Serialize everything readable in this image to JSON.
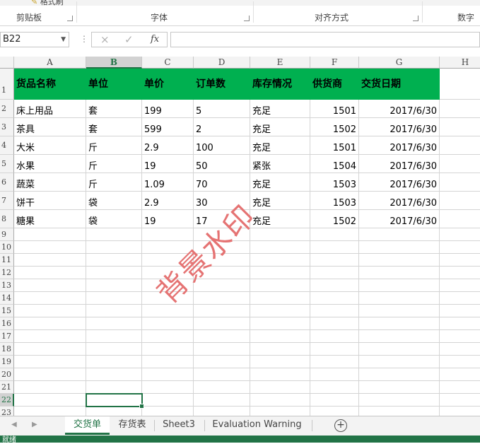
{
  "ribbon": {
    "format_painter": "格式刷",
    "groups": [
      "剪贴板",
      "字体",
      "对齐方式",
      "数字"
    ]
  },
  "formula_bar": {
    "name_box": "B22",
    "cancel_icon": "×",
    "enter_icon": "✓",
    "fx_label": "fx",
    "formula": ""
  },
  "columns": [
    "A",
    "B",
    "C",
    "D",
    "E",
    "F",
    "G",
    "H"
  ],
  "rows": [
    "1",
    "2",
    "3",
    "4",
    "5",
    "6",
    "7",
    "8",
    "9",
    "10",
    "11",
    "12",
    "13",
    "14",
    "15",
    "16",
    "17",
    "18",
    "19",
    "20",
    "21",
    "22",
    "23"
  ],
  "table": {
    "header": [
      "货品名称",
      "单位",
      "单价",
      "订单数",
      "库存情况",
      "供货商",
      "交货日期"
    ],
    "records": [
      [
        "床上用品",
        "套",
        "199",
        "5",
        "充足",
        "1501",
        "2017/6/30"
      ],
      [
        "茶具",
        "套",
        "599",
        "2",
        "充足",
        "1502",
        "2017/6/30"
      ],
      [
        "大米",
        "斤",
        "2.9",
        "100",
        "充足",
        "1501",
        "2017/6/30"
      ],
      [
        "水果",
        "斤",
        "19",
        "50",
        "紧张",
        "1504",
        "2017/6/30"
      ],
      [
        "蔬菜",
        "斤",
        "1.09",
        "70",
        "充足",
        "1503",
        "2017/6/30"
      ],
      [
        "饼干",
        "袋",
        "2.9",
        "30",
        "充足",
        "1503",
        "2017/6/30"
      ],
      [
        "糖果",
        "袋",
        "19",
        "17",
        "充足",
        "1502",
        "2017/6/30"
      ]
    ],
    "header_fill": "#00b050"
  },
  "watermark": "背景水印",
  "sheet_tabs": [
    "交货单",
    "存货表",
    "Sheet3",
    "Evaluation Warning"
  ],
  "active_tab": "交货单",
  "status_text": "就绪",
  "accent": "#217346",
  "selected_cell": "B22"
}
